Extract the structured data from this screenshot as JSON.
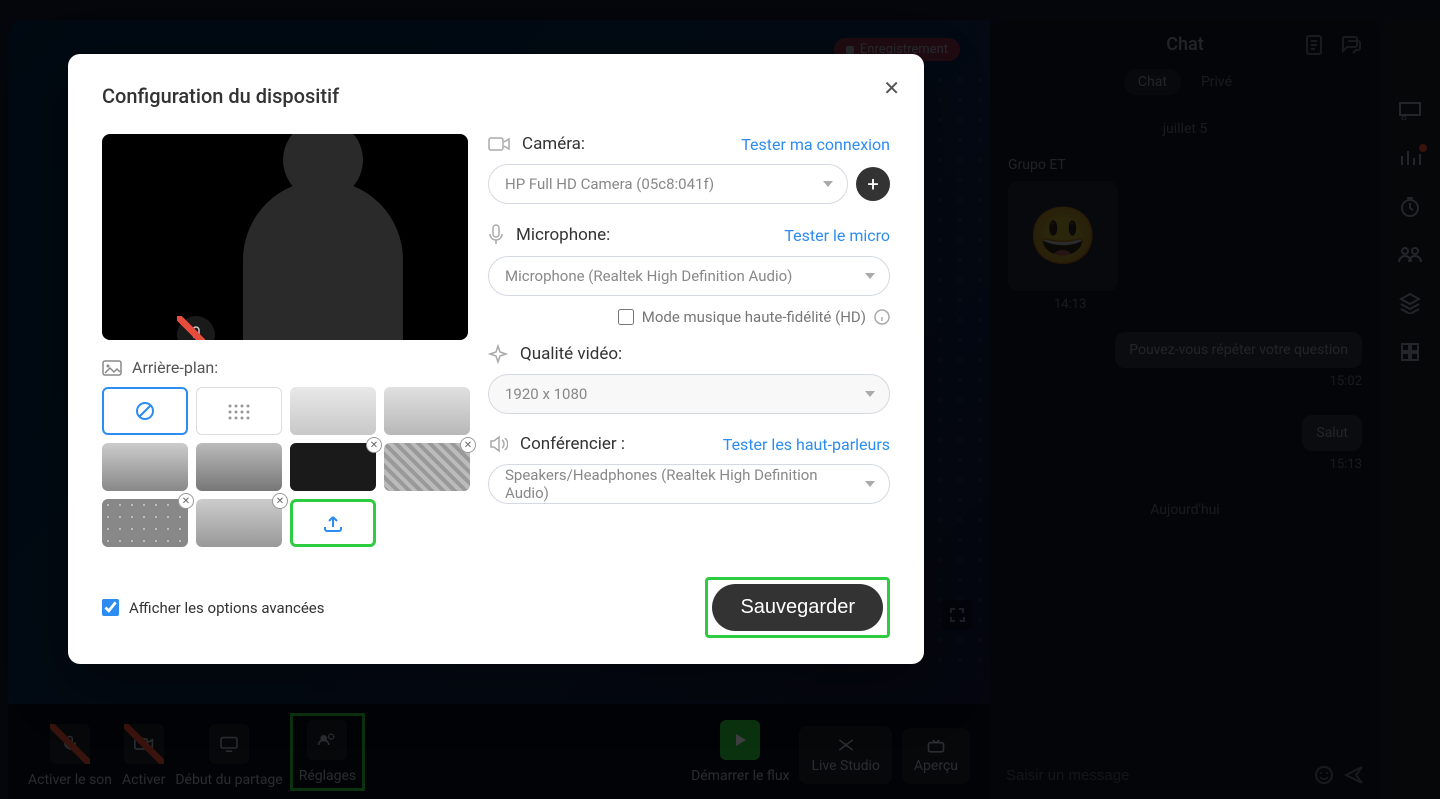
{
  "topbar": {
    "recording": "Enregistrement"
  },
  "toolbar": {
    "activate_sound": "Activer le son",
    "activate": "Activer",
    "start_share": "Début du partage",
    "settings": "Réglages",
    "start_stream": "Démarrer le flux",
    "live_studio": "Live Studio",
    "preview": "Aperçu"
  },
  "chat": {
    "title": "Chat",
    "tab_chat": "Chat",
    "tab_private": "Privé",
    "date1": "juillet 5",
    "sender1": "Grupo ET",
    "time1": "14:13",
    "msg1": "Pouvez-vous répéter votre question",
    "time2": "15:02",
    "msg2": "Salut",
    "time3": "15:13",
    "date2": "Aujourd'hui",
    "input_placeholder": "Saisir un message"
  },
  "modal": {
    "title": "Configuration du dispositif",
    "background_label": "Arrière-plan:",
    "camera_label": "Caméra:",
    "camera_test": "Tester ma connexion",
    "camera_value": "HP Full HD Camera (05c8:041f)",
    "mic_label": "Microphone:",
    "mic_test": "Tester le micro",
    "mic_value": "Microphone (Realtek High Definition Audio)",
    "hifi_label": "Mode musique haute-fidélité (HD)",
    "quality_label": "Qualité vidéo:",
    "quality_value": "1920 x 1080",
    "speaker_label": "Conférencier :",
    "speaker_test": "Tester les haut-parleurs",
    "speaker_value": "Speakers/Headphones (Realtek High Definition Audio)",
    "advanced_label": "Afficher les options avancées",
    "save": "Sauvegarder"
  }
}
